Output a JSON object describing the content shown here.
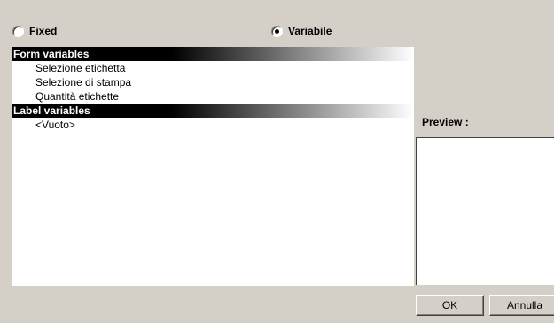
{
  "mode": {
    "fixed_label": "Fixed",
    "variable_label": "Variabile",
    "selected": "variable"
  },
  "form_variables": {
    "header": "Form variables",
    "items": [
      "Selezione etichetta",
      "Selezione di stampa",
      "Quantità etichette"
    ]
  },
  "label_variables": {
    "header": "Label variables",
    "items": [
      "<Vuoto>"
    ]
  },
  "preview": {
    "label": "Preview :"
  },
  "buttons": {
    "ok": "OK",
    "cancel": "Annulla"
  }
}
